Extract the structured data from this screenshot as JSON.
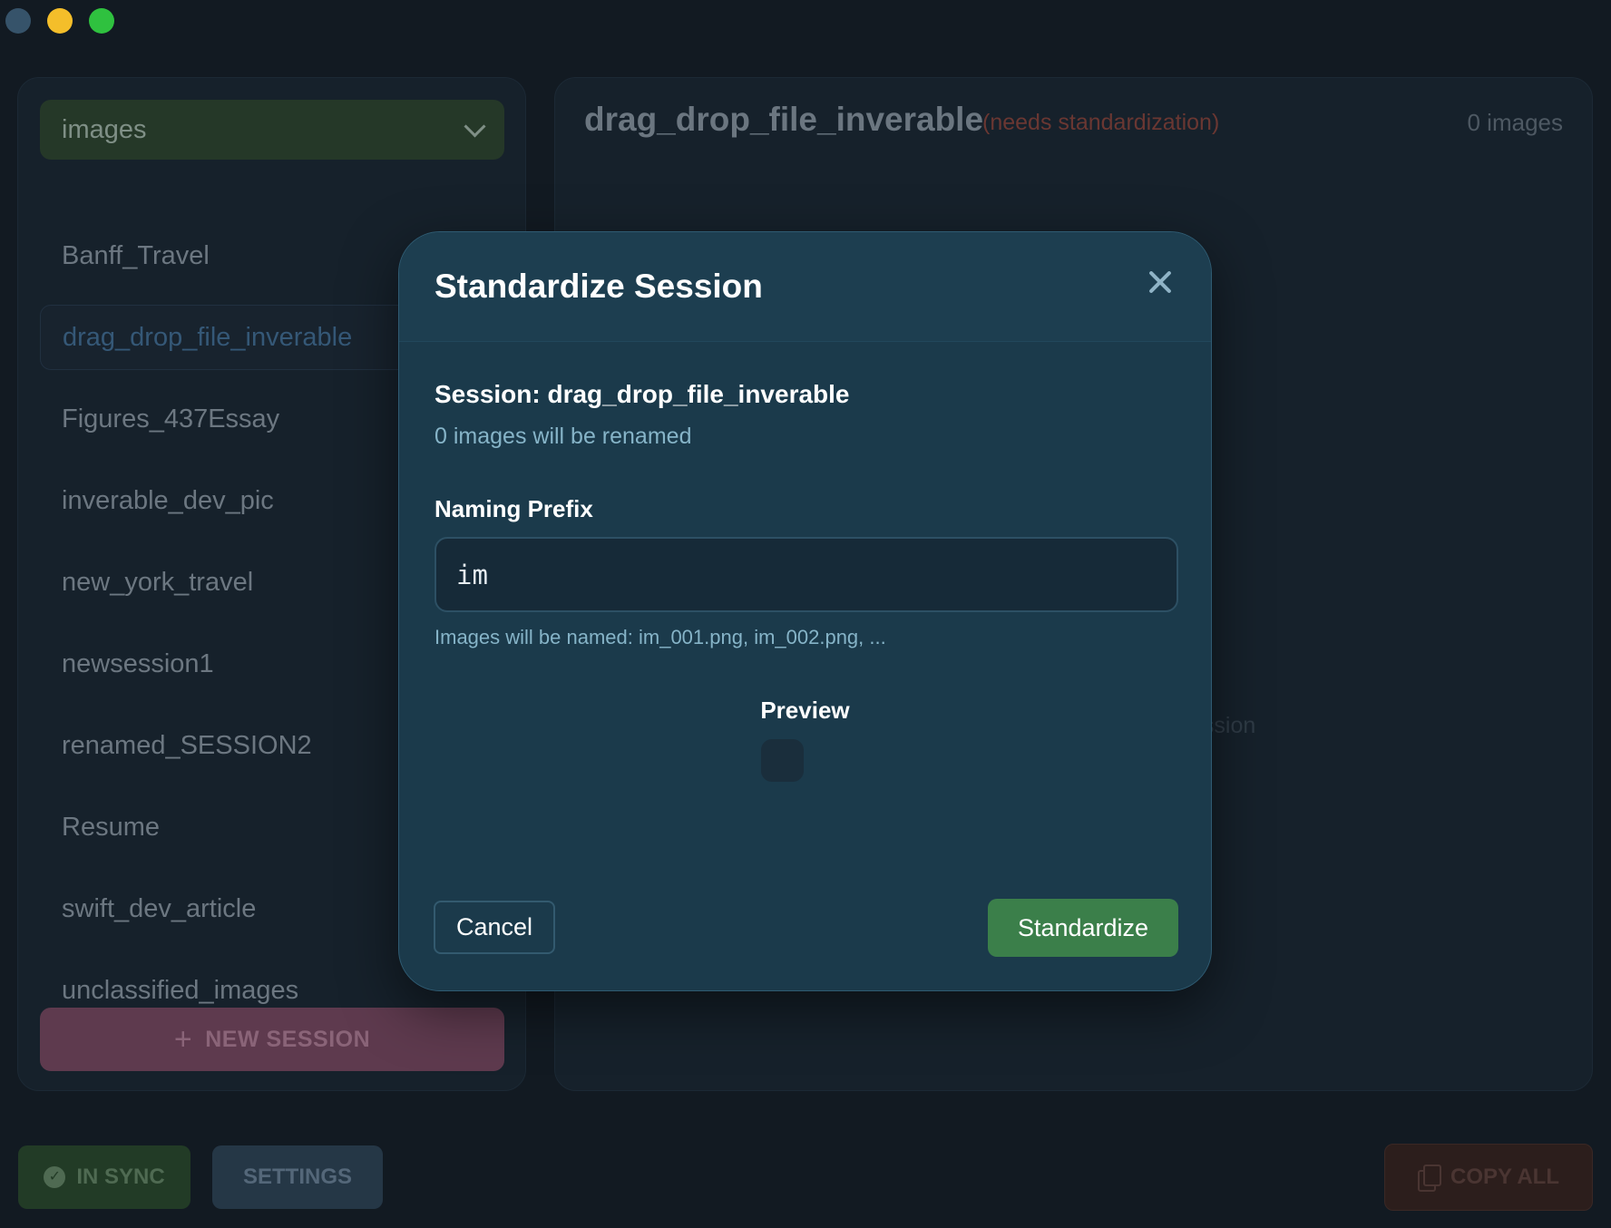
{
  "sidebar": {
    "category": "images",
    "sessions": [
      {
        "label": "Banff_Travel"
      },
      {
        "label": "drag_drop_file_inverable"
      },
      {
        "label": "Figures_437Essay"
      },
      {
        "label": "inverable_dev_pic"
      },
      {
        "label": "new_york_travel"
      },
      {
        "label": "newsession1"
      },
      {
        "label": "renamed_SESSION2"
      },
      {
        "label": "Resume"
      },
      {
        "label": "swift_dev_article"
      },
      {
        "label": "unclassified_images"
      }
    ],
    "new_session_label": "NEW SESSION"
  },
  "main": {
    "title": "drag_drop_file_inverable",
    "badge": "(needs standardization)",
    "count": "0 images",
    "hint": "ession"
  },
  "footer": {
    "sync_label": "IN SYNC",
    "settings_label": "SETTINGS",
    "copy_all_label": "COPY ALL"
  },
  "modal": {
    "title": "Standardize Session",
    "session_label": "Session: drag_drop_file_inverable",
    "rename_count": "0 images will be renamed",
    "prefix_label": "Naming Prefix",
    "prefix_value": "im",
    "name_example": "Images will be named: im_001.png, im_002.png, ...",
    "preview_title": "Preview",
    "cancel_label": "Cancel",
    "standardize_label": "Standardize"
  },
  "colors": {
    "background": "#121a22",
    "modal_bg": "#1b3a4b",
    "accent_green": "#3b7f4a",
    "badge_red": "#6a3732",
    "new_session_bg": "#5e3a4e"
  },
  "icons": [
    "chevron-down-icon",
    "plus-icon",
    "check-circle-icon",
    "copy-icon",
    "close-icon"
  ]
}
